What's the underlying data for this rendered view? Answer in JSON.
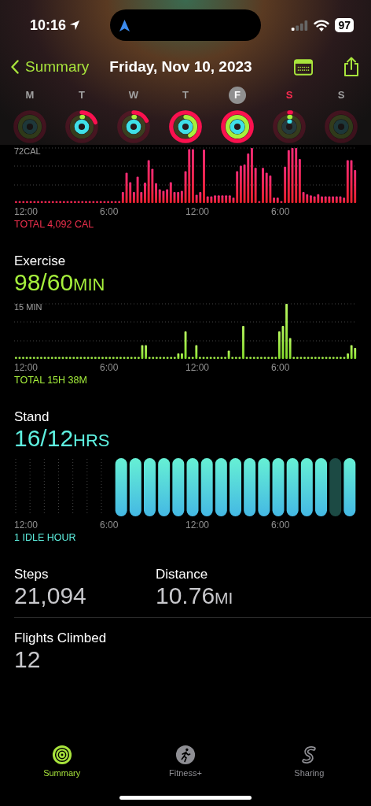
{
  "status_bar": {
    "time": "10:16",
    "battery": "97"
  },
  "nav": {
    "back": "Summary",
    "title": "Friday, Nov 10, 2023"
  },
  "week": [
    {
      "label": "M",
      "selected": false,
      "today": false
    },
    {
      "label": "T",
      "selected": false,
      "today": false
    },
    {
      "label": "W",
      "selected": false,
      "today": false
    },
    {
      "label": "T",
      "selected": false,
      "today": false
    },
    {
      "label": "F",
      "selected": true,
      "today": false
    },
    {
      "label": "S",
      "selected": false,
      "today": true
    },
    {
      "label": "S",
      "selected": false,
      "today": false
    }
  ],
  "move": {
    "scale_label": "72CAL",
    "axis_labels": [
      "12:00",
      "6:00",
      "12:00",
      "6:00"
    ],
    "total": "TOTAL 4,092 CAL"
  },
  "exercise": {
    "title": "Exercise",
    "value": "98/60",
    "unit": "MIN",
    "scale_label": "15 MIN",
    "axis_labels": [
      "12:00",
      "6:00",
      "12:00",
      "6:00"
    ],
    "total": "TOTAL 15H 38M"
  },
  "stand": {
    "title": "Stand",
    "value": "16/12",
    "unit": "HRS",
    "axis_labels": [
      "12:00",
      "6:00",
      "12:00",
      "6:00"
    ],
    "total": "1 IDLE HOUR"
  },
  "stats": [
    {
      "label": "Steps",
      "value": "21,094"
    },
    {
      "label": "Distance",
      "value": "10.76",
      "unit": "MI"
    },
    {
      "label": "Flights Climbed",
      "value": "12"
    }
  ],
  "tabs": [
    {
      "label": "Summary",
      "selected": true,
      "kind": "rings"
    },
    {
      "label": "Fitness+",
      "selected": false,
      "kind": "runner"
    },
    {
      "label": "Sharing",
      "selected": false,
      "kind": "sharing"
    }
  ]
}
